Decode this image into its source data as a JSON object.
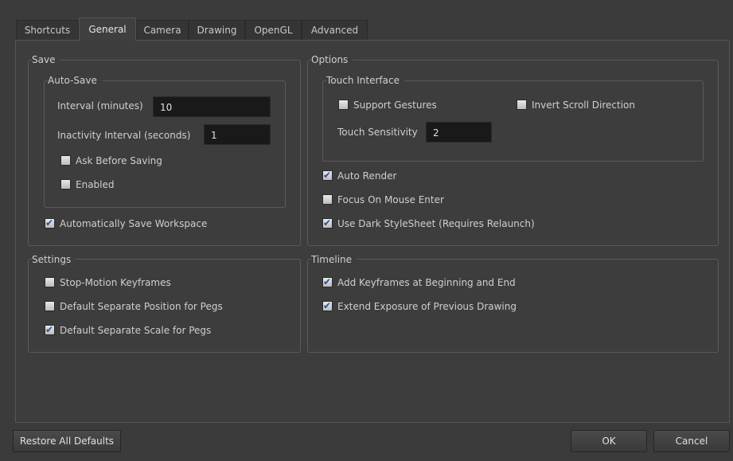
{
  "tabs": [
    "Shortcuts",
    "General",
    "Camera",
    "Drawing",
    "OpenGL",
    "Advanced"
  ],
  "active_tab": "General",
  "save": {
    "title": "Save",
    "autosave": {
      "title": "Auto-Save",
      "interval_label": "Interval (minutes)",
      "interval_value": "10",
      "inactivity_label": "Inactivity Interval (seconds)",
      "inactivity_value": "1",
      "ask_before_saving": {
        "label": "Ask Before Saving",
        "checked": false
      },
      "enabled": {
        "label": "Enabled",
        "checked": false
      }
    },
    "auto_save_workspace": {
      "label": "Automatically Save Workspace",
      "checked": true
    }
  },
  "options": {
    "title": "Options",
    "touch": {
      "title": "Touch Interface",
      "support_gestures": {
        "label": "Support Gestures",
        "checked": false
      },
      "invert_scroll": {
        "label": "Invert Scroll Direction",
        "checked": false
      },
      "sensitivity_label": "Touch Sensitivity",
      "sensitivity_value": "2"
    },
    "auto_render": {
      "label": "Auto Render",
      "checked": true
    },
    "focus_on_mouse_enter": {
      "label": "Focus On Mouse Enter",
      "checked": false
    },
    "dark_stylesheet": {
      "label": "Use Dark StyleSheet (Requires Relaunch)",
      "checked": true
    }
  },
  "settings": {
    "title": "Settings",
    "stop_motion": {
      "label": "Stop-Motion Keyframes",
      "checked": false
    },
    "sep_position": {
      "label": "Default Separate Position for Pegs",
      "checked": false
    },
    "sep_scale": {
      "label": "Default Separate Scale for Pegs",
      "checked": true
    }
  },
  "timeline": {
    "title": "Timeline",
    "add_keyframes": {
      "label": "Add Keyframes at Beginning and End",
      "checked": true
    },
    "extend_exposure": {
      "label": "Extend Exposure of Previous Drawing",
      "checked": true
    }
  },
  "buttons": {
    "restore": "Restore All Defaults",
    "ok": "OK",
    "cancel": "Cancel"
  }
}
